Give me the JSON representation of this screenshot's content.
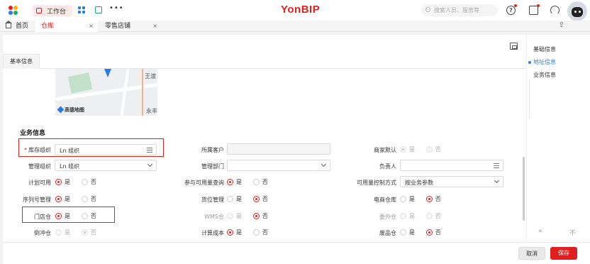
{
  "topbar": {
    "workspace_tab": "工作台",
    "brand": "YonBIP",
    "search_placeholder": "搜索人员、服务等",
    "help_label": "?",
    "more_label": "•••"
  },
  "tabs": [
    {
      "label": "首页",
      "closable": false
    },
    {
      "label": "仓库",
      "closable": true,
      "active": true
    },
    {
      "label": "零售店铺",
      "closable": true
    }
  ],
  "tabbar_right_icons": "⇧",
  "close_glyph": "×",
  "subtabs": [
    "基本信息"
  ],
  "map": {
    "road_label_top": "王渡",
    "road_label_bottom": "永丰",
    "logo_text": "高德地图"
  },
  "section_title": "业务信息",
  "fields": {
    "inventory_org": {
      "label": "库存组织",
      "value": "Ln 组织",
      "required": true
    },
    "customer": {
      "label": "所属客户",
      "value": ""
    },
    "merchant_default": {
      "label": "商家默认"
    },
    "manage_org": {
      "label": "管理组织",
      "value": "Ln 组织"
    },
    "manage_dept": {
      "label": "管理部门",
      "value": ""
    },
    "owner": {
      "label": "负责人",
      "value": ""
    },
    "plan_available": {
      "label": "计划可用"
    },
    "avail_query": {
      "label": "参与可用量查询"
    },
    "avail_control": {
      "label": "可用量控制方式",
      "value": "按业务参数"
    },
    "serial_mgmt": {
      "label": "序列号管理"
    },
    "location_mgmt": {
      "label": "货位管理"
    },
    "ecom_wh": {
      "label": "电商仓库"
    },
    "store_wh": {
      "label": "门店仓"
    },
    "wms_wh": {
      "label": "WMS仓"
    },
    "outsource_wh": {
      "label": "委外仓"
    },
    "rush_wh": {
      "label": "倒冲仓"
    },
    "calc_cost": {
      "label": "计算成本"
    },
    "waste_wh": {
      "label": "废品仓"
    }
  },
  "yes": "是",
  "no": "否",
  "anchors": [
    "基础信息",
    "地址信息",
    "业务信息"
  ],
  "nav": {
    "prev": "»",
    "next": "不"
  },
  "footer": {
    "cancel": "取消",
    "save": "保存"
  }
}
